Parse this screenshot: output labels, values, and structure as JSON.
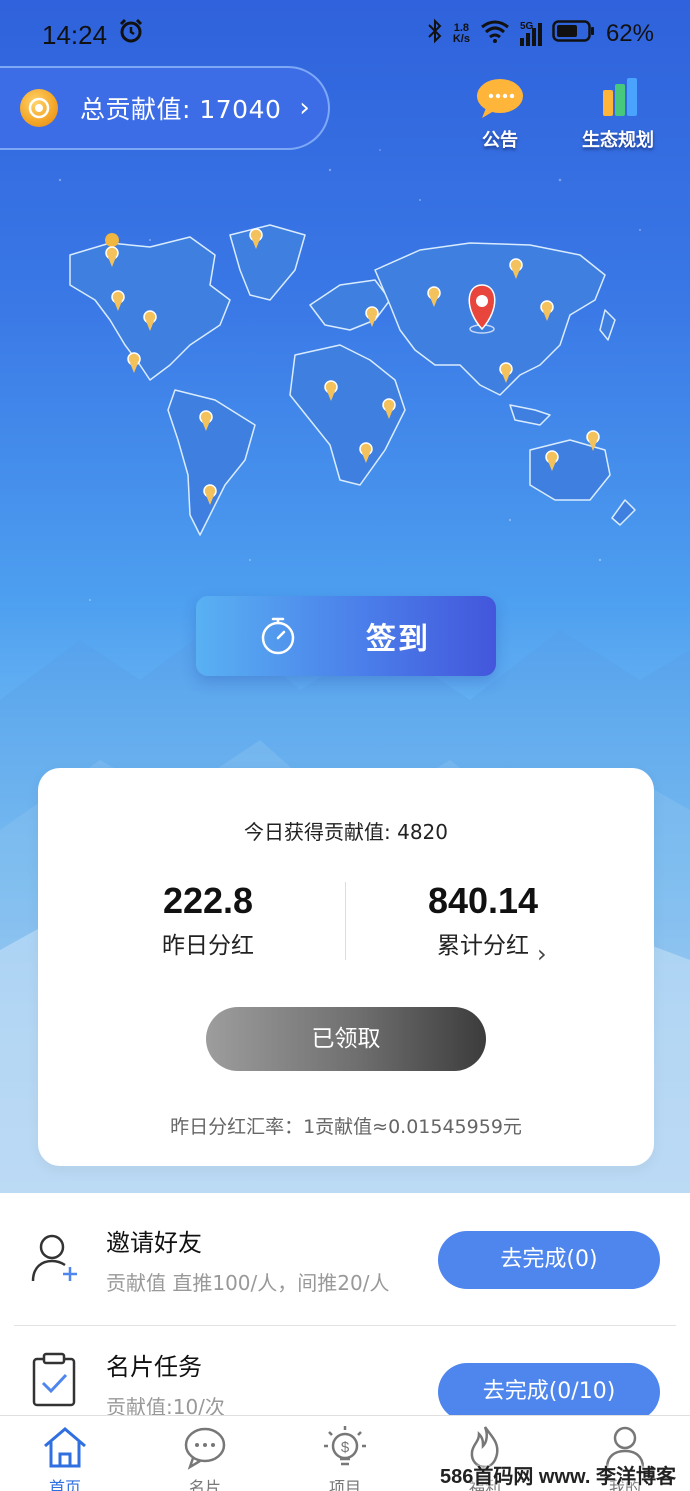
{
  "status_bar": {
    "time": "14:24",
    "net_speed_value": "1.8",
    "net_speed_unit": "K/s",
    "signal_type": "5G",
    "battery": "62%"
  },
  "header": {
    "total_contribution_label": "总贡献值: 17040",
    "announcement_label": "公告",
    "ecosystem_plan_label": "生态规划"
  },
  "checkin": {
    "label": "签到"
  },
  "summary_card": {
    "today_label": "今日获得贡献值: 4820",
    "yesterday_dividend_value": "222.8",
    "yesterday_dividend_label": "昨日分红",
    "total_dividend_value": "840.14",
    "total_dividend_label": "累计分红",
    "claimed_button": "已领取",
    "rate_text": "昨日分红汇率：1贡献值≈0.01545959元"
  },
  "tasks": [
    {
      "title": "邀请好友",
      "desc": "贡献值 直推100/人，间推20/人",
      "button": "去完成(0)"
    },
    {
      "title": "名片任务",
      "desc": "贡献值:10/次",
      "button": "去完成(0/10)"
    }
  ],
  "tabbar": [
    {
      "label": "首页",
      "icon": "home-icon",
      "active": true
    },
    {
      "label": "名片",
      "icon": "chat-icon",
      "active": false
    },
    {
      "label": "项目",
      "icon": "lightbulb-icon",
      "active": false
    },
    {
      "label": "福利",
      "icon": "flame-icon",
      "active": false
    },
    {
      "label": "我的",
      "icon": "user-icon",
      "active": false
    }
  ],
  "watermark": "586首码网 www.  李洋博客",
  "colors": {
    "primary": "#4e86ee",
    "hero_top": "#2f62dc",
    "active_tab": "#2f6fe0",
    "claimed_dark": "#3c3c3c"
  }
}
